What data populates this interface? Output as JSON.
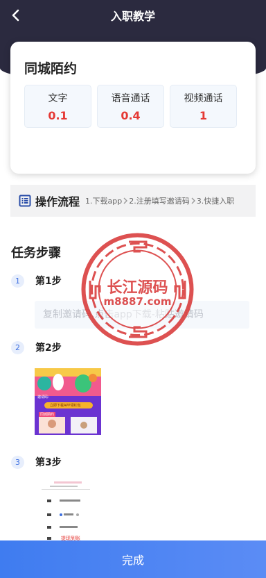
{
  "header": {
    "title": "入职教学"
  },
  "card": {
    "title": "同城陌约",
    "prices": [
      {
        "label": "文字",
        "value": "0.1"
      },
      {
        "label": "语音通话",
        "value": "0.4"
      },
      {
        "label": "视频通话",
        "value": "1"
      }
    ]
  },
  "process": {
    "title": "操作流程",
    "steps": [
      "1.下载app",
      "2.注册填写邀请码",
      "3.快捷入职"
    ]
  },
  "tasks": {
    "title": "任务步骤",
    "steps": [
      {
        "num": "1",
        "label": "第1步"
      },
      {
        "num": "2",
        "label": "第2步"
      },
      {
        "num": "3",
        "label": "第3步"
      }
    ],
    "code_placeholder": "复制邀请码,点击app下载-粘贴邀请码"
  },
  "screenshot2": {
    "promo_label": "邀请码：",
    "promo_button": "立即下载APP领红包",
    "tag": "同城陌约"
  },
  "screenshot3": {
    "red_text": "提现到账"
  },
  "watermark": {
    "name": "长江源码",
    "url": "m8887.com"
  },
  "footer": {
    "done_label": "完成"
  },
  "colors": {
    "header": "#2b2a3f",
    "price": "#e53935",
    "accent": "#3d6fe0",
    "watermark": "#d62b2b"
  }
}
